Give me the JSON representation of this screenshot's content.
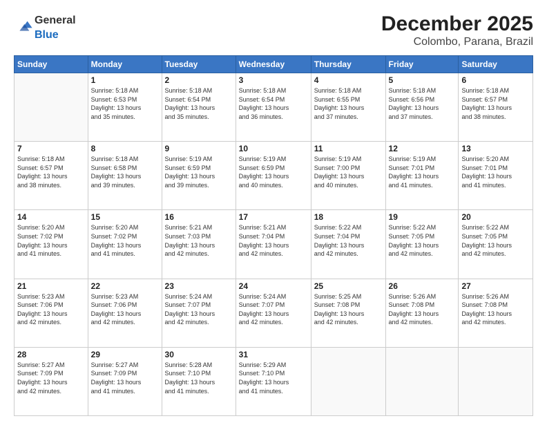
{
  "header": {
    "logo_general": "General",
    "logo_blue": "Blue",
    "title": "December 2025",
    "subtitle": "Colombo, Parana, Brazil"
  },
  "calendar": {
    "days_of_week": [
      "Sunday",
      "Monday",
      "Tuesday",
      "Wednesday",
      "Thursday",
      "Friday",
      "Saturday"
    ],
    "weeks": [
      [
        {
          "day": "",
          "sunrise": "",
          "sunset": "",
          "daylight": ""
        },
        {
          "day": "1",
          "sunrise": "Sunrise: 5:18 AM",
          "sunset": "Sunset: 6:53 PM",
          "daylight": "Daylight: 13 hours and 35 minutes."
        },
        {
          "day": "2",
          "sunrise": "Sunrise: 5:18 AM",
          "sunset": "Sunset: 6:54 PM",
          "daylight": "Daylight: 13 hours and 35 minutes."
        },
        {
          "day": "3",
          "sunrise": "Sunrise: 5:18 AM",
          "sunset": "Sunset: 6:54 PM",
          "daylight": "Daylight: 13 hours and 36 minutes."
        },
        {
          "day": "4",
          "sunrise": "Sunrise: 5:18 AM",
          "sunset": "Sunset: 6:55 PM",
          "daylight": "Daylight: 13 hours and 37 minutes."
        },
        {
          "day": "5",
          "sunrise": "Sunrise: 5:18 AM",
          "sunset": "Sunset: 6:56 PM",
          "daylight": "Daylight: 13 hours and 37 minutes."
        },
        {
          "day": "6",
          "sunrise": "Sunrise: 5:18 AM",
          "sunset": "Sunset: 6:57 PM",
          "daylight": "Daylight: 13 hours and 38 minutes."
        }
      ],
      [
        {
          "day": "7",
          "sunrise": "Sunrise: 5:18 AM",
          "sunset": "Sunset: 6:57 PM",
          "daylight": "Daylight: 13 hours and 38 minutes."
        },
        {
          "day": "8",
          "sunrise": "Sunrise: 5:18 AM",
          "sunset": "Sunset: 6:58 PM",
          "daylight": "Daylight: 13 hours and 39 minutes."
        },
        {
          "day": "9",
          "sunrise": "Sunrise: 5:19 AM",
          "sunset": "Sunset: 6:59 PM",
          "daylight": "Daylight: 13 hours and 39 minutes."
        },
        {
          "day": "10",
          "sunrise": "Sunrise: 5:19 AM",
          "sunset": "Sunset: 6:59 PM",
          "daylight": "Daylight: 13 hours and 40 minutes."
        },
        {
          "day": "11",
          "sunrise": "Sunrise: 5:19 AM",
          "sunset": "Sunset: 7:00 PM",
          "daylight": "Daylight: 13 hours and 40 minutes."
        },
        {
          "day": "12",
          "sunrise": "Sunrise: 5:19 AM",
          "sunset": "Sunset: 7:01 PM",
          "daylight": "Daylight: 13 hours and 41 minutes."
        },
        {
          "day": "13",
          "sunrise": "Sunrise: 5:20 AM",
          "sunset": "Sunset: 7:01 PM",
          "daylight": "Daylight: 13 hours and 41 minutes."
        }
      ],
      [
        {
          "day": "14",
          "sunrise": "Sunrise: 5:20 AM",
          "sunset": "Sunset: 7:02 PM",
          "daylight": "Daylight: 13 hours and 41 minutes."
        },
        {
          "day": "15",
          "sunrise": "Sunrise: 5:20 AM",
          "sunset": "Sunset: 7:02 PM",
          "daylight": "Daylight: 13 hours and 41 minutes."
        },
        {
          "day": "16",
          "sunrise": "Sunrise: 5:21 AM",
          "sunset": "Sunset: 7:03 PM",
          "daylight": "Daylight: 13 hours and 42 minutes."
        },
        {
          "day": "17",
          "sunrise": "Sunrise: 5:21 AM",
          "sunset": "Sunset: 7:04 PM",
          "daylight": "Daylight: 13 hours and 42 minutes."
        },
        {
          "day": "18",
          "sunrise": "Sunrise: 5:22 AM",
          "sunset": "Sunset: 7:04 PM",
          "daylight": "Daylight: 13 hours and 42 minutes."
        },
        {
          "day": "19",
          "sunrise": "Sunrise: 5:22 AM",
          "sunset": "Sunset: 7:05 PM",
          "daylight": "Daylight: 13 hours and 42 minutes."
        },
        {
          "day": "20",
          "sunrise": "Sunrise: 5:22 AM",
          "sunset": "Sunset: 7:05 PM",
          "daylight": "Daylight: 13 hours and 42 minutes."
        }
      ],
      [
        {
          "day": "21",
          "sunrise": "Sunrise: 5:23 AM",
          "sunset": "Sunset: 7:06 PM",
          "daylight": "Daylight: 13 hours and 42 minutes."
        },
        {
          "day": "22",
          "sunrise": "Sunrise: 5:23 AM",
          "sunset": "Sunset: 7:06 PM",
          "daylight": "Daylight: 13 hours and 42 minutes."
        },
        {
          "day": "23",
          "sunrise": "Sunrise: 5:24 AM",
          "sunset": "Sunset: 7:07 PM",
          "daylight": "Daylight: 13 hours and 42 minutes."
        },
        {
          "day": "24",
          "sunrise": "Sunrise: 5:24 AM",
          "sunset": "Sunset: 7:07 PM",
          "daylight": "Daylight: 13 hours and 42 minutes."
        },
        {
          "day": "25",
          "sunrise": "Sunrise: 5:25 AM",
          "sunset": "Sunset: 7:08 PM",
          "daylight": "Daylight: 13 hours and 42 minutes."
        },
        {
          "day": "26",
          "sunrise": "Sunrise: 5:26 AM",
          "sunset": "Sunset: 7:08 PM",
          "daylight": "Daylight: 13 hours and 42 minutes."
        },
        {
          "day": "27",
          "sunrise": "Sunrise: 5:26 AM",
          "sunset": "Sunset: 7:08 PM",
          "daylight": "Daylight: 13 hours and 42 minutes."
        }
      ],
      [
        {
          "day": "28",
          "sunrise": "Sunrise: 5:27 AM",
          "sunset": "Sunset: 7:09 PM",
          "daylight": "Daylight: 13 hours and 42 minutes."
        },
        {
          "day": "29",
          "sunrise": "Sunrise: 5:27 AM",
          "sunset": "Sunset: 7:09 PM",
          "daylight": "Daylight: 13 hours and 41 minutes."
        },
        {
          "day": "30",
          "sunrise": "Sunrise: 5:28 AM",
          "sunset": "Sunset: 7:10 PM",
          "daylight": "Daylight: 13 hours and 41 minutes."
        },
        {
          "day": "31",
          "sunrise": "Sunrise: 5:29 AM",
          "sunset": "Sunset: 7:10 PM",
          "daylight": "Daylight: 13 hours and 41 minutes."
        },
        {
          "day": "",
          "sunrise": "",
          "sunset": "",
          "daylight": ""
        },
        {
          "day": "",
          "sunrise": "",
          "sunset": "",
          "daylight": ""
        },
        {
          "day": "",
          "sunrise": "",
          "sunset": "",
          "daylight": ""
        }
      ]
    ]
  }
}
